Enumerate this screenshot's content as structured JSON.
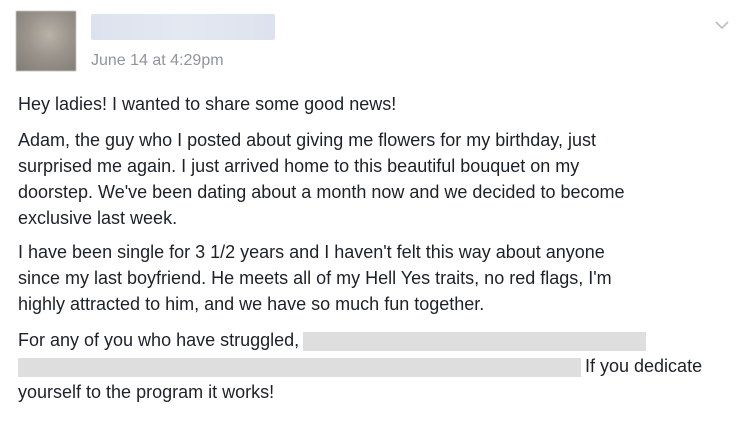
{
  "post": {
    "timestamp": "June 14 at 4:29pm",
    "paragraphs": {
      "p1": "Hey ladies! I wanted to share some good news!",
      "p2_lines": [
        "Adam, the guy who I posted about giving me flowers for my birthday, just",
        "surprised me again. I just arrived home to this beautiful bouquet on my",
        "doorstep. We've been dating about a month now and we decided to become",
        "exclusive last week."
      ],
      "p3_lines": [
        "I have been single for 3 1/2 years and I haven't felt this way about anyone",
        "since my last boyfriend. He meets all of my Hell Yes traits, no red flags, I'm",
        "highly attracted to him, and we have so much fun together."
      ],
      "p4": {
        "start": "For any of you who have struggled,",
        "middle": "If you dedicate",
        "end": "yourself to the program it works!"
      }
    }
  },
  "icons": {
    "menu": "chevron-down-icon"
  }
}
